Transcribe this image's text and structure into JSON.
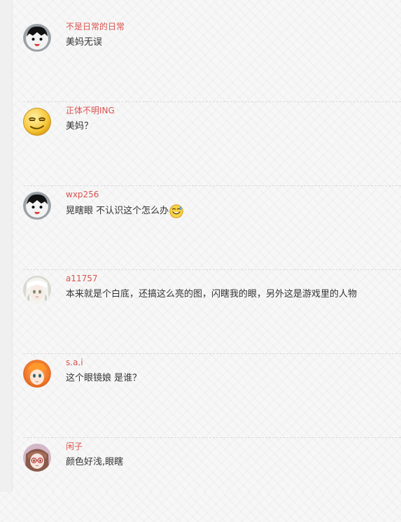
{
  "comments": [
    {
      "username": "不是日常的日常",
      "text": "美妈无误",
      "avatar_icon": "boy-face-icon"
    },
    {
      "username": "正体不明ING",
      "text": "美妈？",
      "avatar_icon": "smirk-face-icon"
    },
    {
      "username": "wxp256",
      "text": "晃瞎眼 不认识这个怎么办",
      "avatar_icon": "boy-face-icon",
      "trailing_emoji": "sweat-laugh-emoji-icon"
    },
    {
      "username": "a11757",
      "text": "本来就是个白底，还搞这么亮的图，闪瞎我的眼，另外这是游戏里的人物",
      "avatar_icon": "anime-white-hair-icon"
    },
    {
      "username": "s.a.i",
      "text": "这个眼镜娘 是谁？",
      "avatar_icon": "anime-orange-hair-icon"
    },
    {
      "username": "闲子",
      "text": "颜色好浅,眼瞎",
      "avatar_icon": "anime-glasses-girl-icon"
    }
  ],
  "colors": {
    "username": "#d9534f",
    "text": "#333333",
    "divider": "#d9d9d9"
  }
}
